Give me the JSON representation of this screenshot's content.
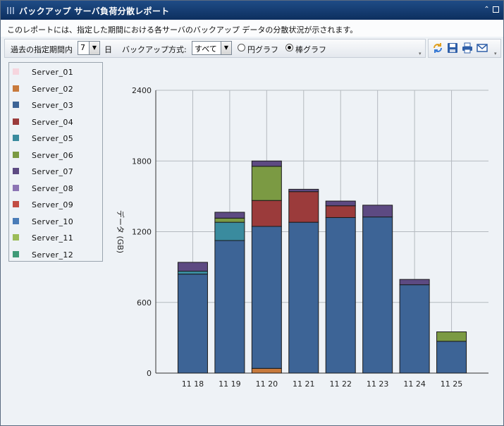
{
  "window": {
    "title": "バックアップ サーバ負荷分散レポート",
    "description": "このレポートには、指定した期間における各サーバのバックアップ データの分散状況が示されます。"
  },
  "controls": {
    "period_label": "過去の指定期間内",
    "period_value": "7",
    "period_unit": "日",
    "method_label": "バックアップ方式:",
    "method_value": "すべて",
    "pie_label": "円グラフ",
    "bar_label": "棒グラフ",
    "selected_chart": "bar"
  },
  "toolbar_icons": [
    "refresh-icon",
    "save-icon",
    "print-icon",
    "email-icon"
  ],
  "chart_data": {
    "type": "bar",
    "stacked": true,
    "categories": [
      "11 18",
      "11 19",
      "11 20",
      "11 21",
      "11 22",
      "11 23",
      "11 24",
      "11 25"
    ],
    "ylabel": "データ (GB)",
    "xlabel": "",
    "ylim": [
      0,
      2400
    ],
    "yticks": [
      0,
      600,
      1200,
      1800,
      2400
    ],
    "grid": true,
    "legend_position": "left",
    "series": [
      {
        "name": "Server_01",
        "color": "#f6d5de",
        "values": [
          0,
          0,
          0,
          0,
          0,
          0,
          0,
          0
        ]
      },
      {
        "name": "Server_02",
        "color": "#c87a3c",
        "values": [
          0,
          0,
          40,
          0,
          0,
          0,
          0,
          0
        ]
      },
      {
        "name": "Server_03",
        "color": "#3d6496",
        "values": [
          840,
          1125,
          1205,
          1280,
          1320,
          1325,
          750,
          270
        ]
      },
      {
        "name": "Server_04",
        "color": "#9b3b3b",
        "values": [
          0,
          0,
          220,
          260,
          100,
          0,
          0,
          0
        ]
      },
      {
        "name": "Server_05",
        "color": "#3a8b9e",
        "values": [
          25,
          155,
          0,
          0,
          0,
          0,
          0,
          0
        ]
      },
      {
        "name": "Server_06",
        "color": "#7b9a43",
        "values": [
          0,
          35,
          290,
          0,
          0,
          0,
          0,
          80
        ]
      },
      {
        "name": "Server_07",
        "color": "#5d4a82",
        "values": [
          75,
          50,
          45,
          20,
          40,
          100,
          45,
          0
        ]
      },
      {
        "name": "Server_08",
        "color": "#8c74b4",
        "values": [
          0,
          0,
          0,
          0,
          0,
          0,
          0,
          0
        ]
      },
      {
        "name": "Server_09",
        "color": "#c24d44",
        "values": [
          0,
          0,
          0,
          0,
          0,
          0,
          0,
          0
        ]
      },
      {
        "name": "Server_10",
        "color": "#4a7cb8",
        "values": [
          0,
          0,
          0,
          0,
          0,
          0,
          0,
          0
        ]
      },
      {
        "name": "Server_11",
        "color": "#9cbc58",
        "values": [
          0,
          0,
          0,
          0,
          0,
          0,
          0,
          0
        ]
      },
      {
        "name": "Server_12",
        "color": "#3f9a78",
        "values": [
          0,
          0,
          0,
          0,
          0,
          0,
          0,
          0
        ]
      }
    ]
  }
}
